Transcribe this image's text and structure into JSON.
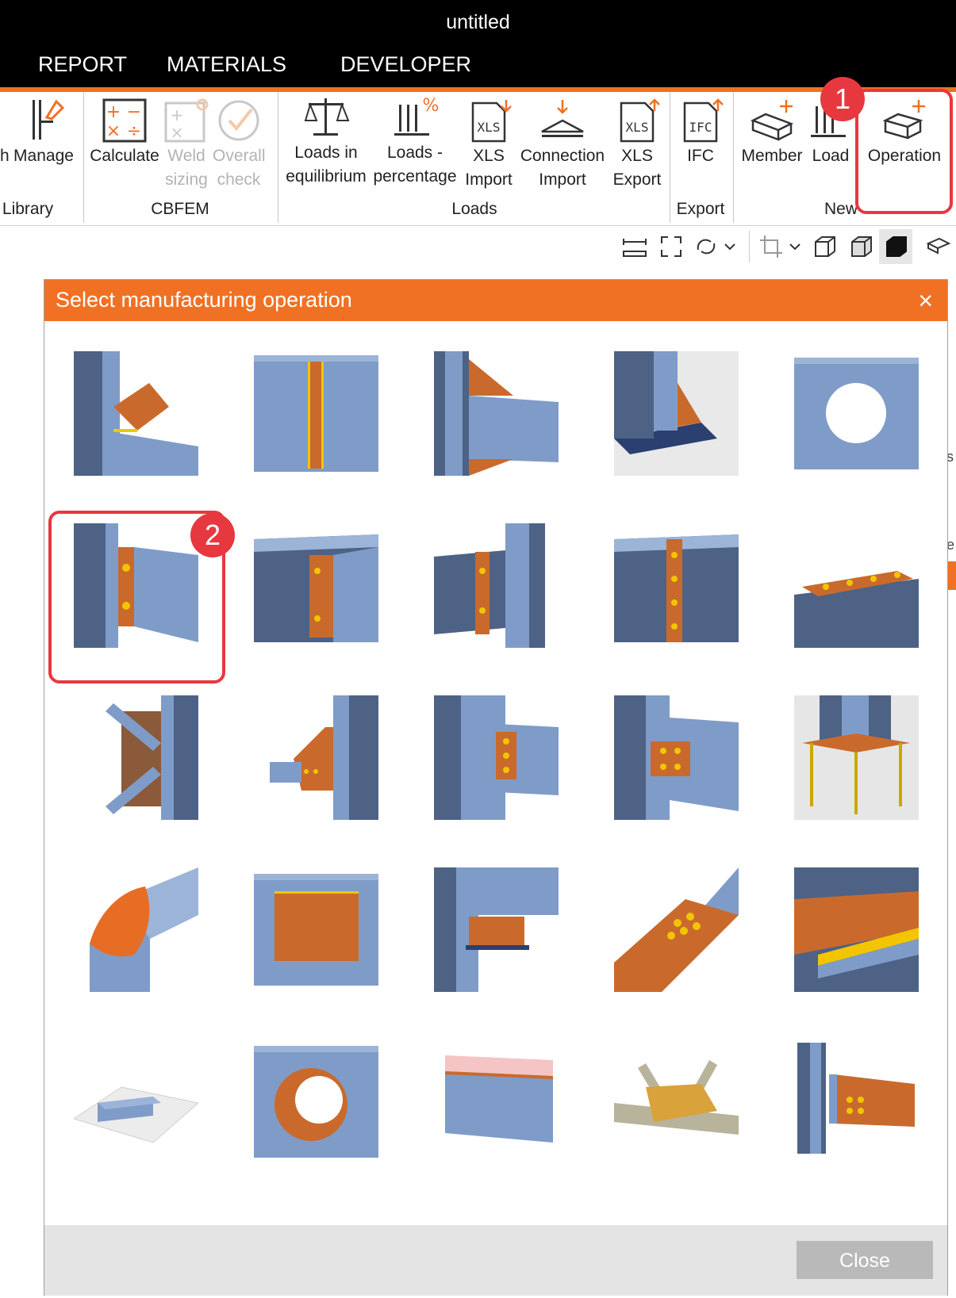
{
  "window": {
    "title": "untitled"
  },
  "menu": {
    "items": [
      "REPORT",
      "MATERIALS",
      "DEVELOPER"
    ]
  },
  "ribbon": {
    "buttons": [
      {
        "label1": "h",
        "label2": ""
      },
      {
        "label1": "Manage",
        "label2": ""
      },
      {
        "label1": "Calculate",
        "label2": ""
      },
      {
        "label1": "Weld",
        "label2": "sizing"
      },
      {
        "label1": "Overall",
        "label2": "check"
      },
      {
        "label1": "Loads in",
        "label2": "equilibrium"
      },
      {
        "label1": "Loads -",
        "label2": "percentage"
      },
      {
        "label1": "XLS",
        "label2": "Import"
      },
      {
        "label1": "Connection",
        "label2": "Import"
      },
      {
        "label1": "XLS",
        "label2": "Export"
      },
      {
        "label1": "IFC",
        "label2": ""
      },
      {
        "label1": "Member",
        "label2": ""
      },
      {
        "label1": "Load",
        "label2": ""
      },
      {
        "label1": "Operation",
        "label2": ""
      }
    ],
    "groups": [
      "Library",
      "CBFEM",
      "Loads",
      "Export",
      "New"
    ],
    "icon_text": {
      "xls": "XLS",
      "ifc": "IFC",
      "percent": "%"
    }
  },
  "callouts": {
    "step1": "1",
    "step2": "2"
  },
  "dialog": {
    "title": "Select manufacturing operation",
    "close_icon": "×",
    "close_label": "Close",
    "tiles": [
      "stiffened-plate-column",
      "web-stiffener",
      "haunch-beam",
      "base-plate-stiffener",
      "web-opening",
      "end-plate-bolted",
      "beam-splice-end-plate",
      "cover-plate-splice",
      "bolted-flange-splice",
      "flange-plate-splice",
      "bracing-gusset",
      "tube-gusset-plate",
      "fin-plate-bolted",
      "angle-cleat-bolted",
      "anchored-base-plate",
      "pipe-mitre-weld",
      "web-doubler-plate",
      "seat-angle",
      "bolted-plate-diagonal",
      "flange-cover-plate",
      "concrete-block",
      "circular-hollow-opening",
      "cut-beam",
      "truss-node-bolted",
      "column-bracket-bolted"
    ]
  },
  "colors": {
    "accent": "#f07124",
    "steel": "#7f9cc8",
    "plate": "#c96a2c",
    "weld": "#f2c500",
    "callout": "#e8383f"
  }
}
